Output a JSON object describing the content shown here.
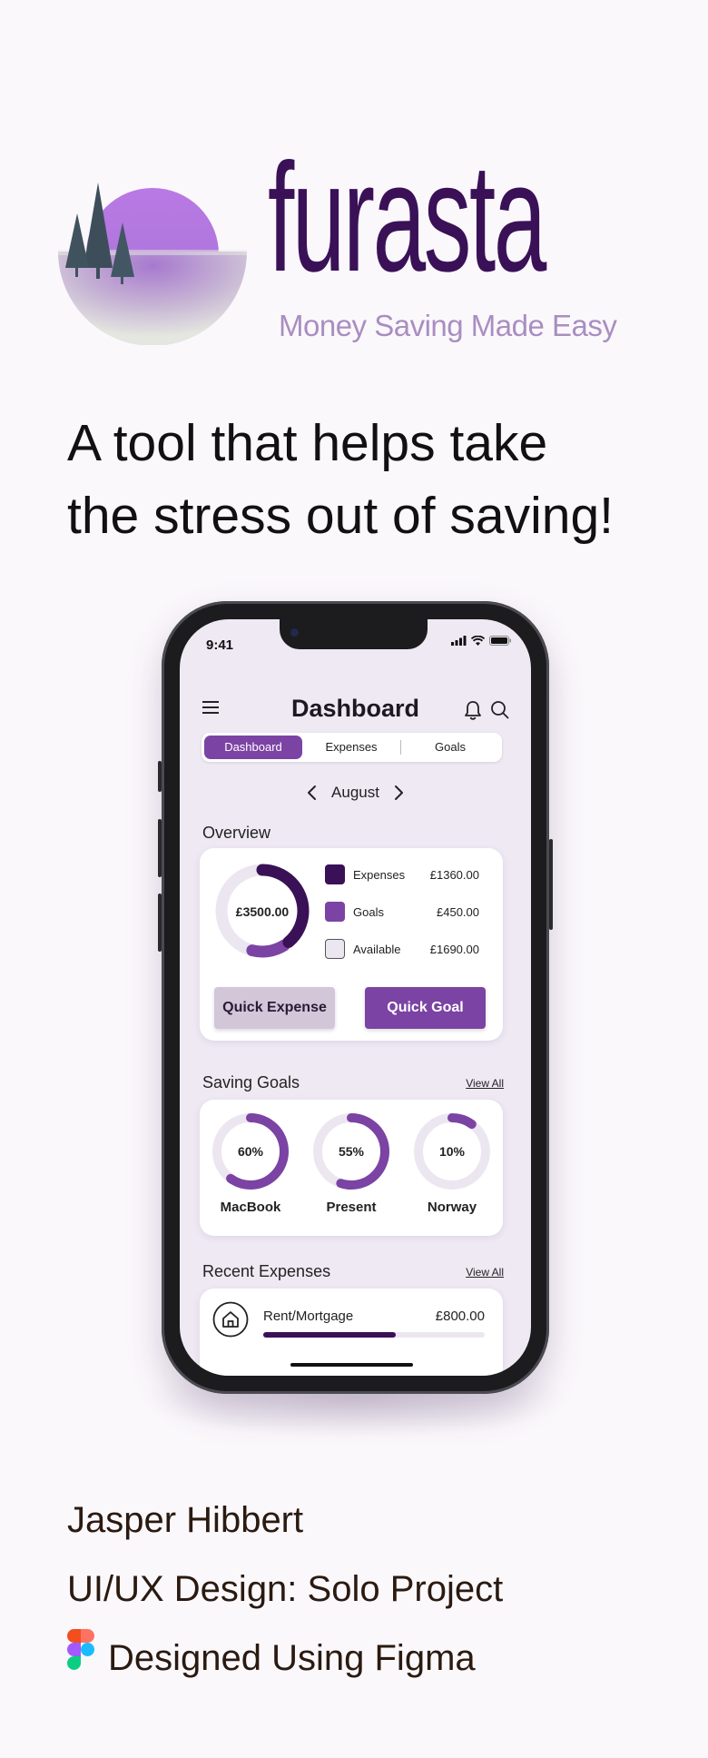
{
  "brand": {
    "name": "furasta",
    "tagline": "Money Saving Made Easy"
  },
  "headline": {
    "line1": "A tool that helps take",
    "line2": "the stress out of saving!"
  },
  "phone": {
    "status": {
      "time": "9:41"
    },
    "header": {
      "title": "Dashboard"
    },
    "tabs": [
      {
        "label": "Dashboard",
        "active": true
      },
      {
        "label": "Expenses",
        "active": false
      },
      {
        "label": "Goals",
        "active": false
      }
    ],
    "month": "August",
    "overview": {
      "title": "Overview",
      "total": "£3500.00",
      "legend": [
        {
          "label": "Expenses",
          "value": "£1360.00",
          "color": "#3a1157"
        },
        {
          "label": "Goals",
          "value": "£450.00",
          "color": "#7b43a3"
        },
        {
          "label": "Available",
          "value": "£1690.00",
          "color": "#ece6f1"
        }
      ],
      "quick_expense_label": "Quick Expense",
      "quick_goal_label": "Quick Goal"
    },
    "saving_goals": {
      "title": "Saving Goals",
      "view_all": "View All",
      "items": [
        {
          "name": "MacBook",
          "percent_label": "60%",
          "progress": 0.6
        },
        {
          "name": "Present",
          "percent_label": "55%",
          "progress": 0.55
        },
        {
          "name": "Norway",
          "percent_label": "10%",
          "progress": 0.1
        }
      ]
    },
    "recent_expenses": {
      "title": "Recent Expenses",
      "view_all": "View All",
      "items": [
        {
          "name": "Rent/Mortgage",
          "amount": "£800.00",
          "progress": 0.6
        }
      ]
    }
  },
  "footer": {
    "author": "Jasper Hibbert",
    "project": "UI/UX Design: Solo Project",
    "tool": "Designed Using Figma"
  },
  "colors": {
    "brand_dark": "#3a1157",
    "brand_purple": "#7b43a3",
    "brand_light": "#ece6f1",
    "logo_sun": "#b979e4"
  }
}
